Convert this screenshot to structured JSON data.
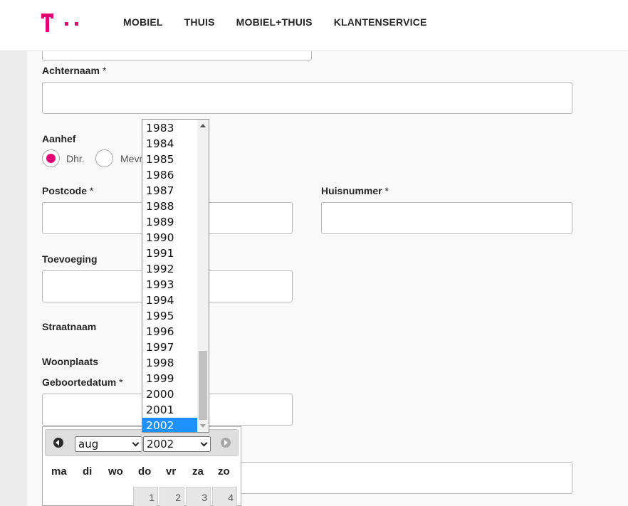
{
  "header": {
    "nav": [
      "MOBIEL",
      "THUIS",
      "MOBIEL+THUIS",
      "KLANTENSERVICE"
    ]
  },
  "form": {
    "achternaam_label": "Achternaam",
    "required_mark": "*",
    "aanhef_label": "Aanhef",
    "aanhef_options": [
      "Dhr.",
      "Mevr."
    ],
    "aanhef_selected": "Dhr.",
    "postcode_label": "Postcode",
    "huisnummer_label": "Huisnummer",
    "toevoeging_label": "Toevoeging",
    "straatnaam_label": "Straatnaam",
    "woonplaats_label": "Woonplaats",
    "geboortedatum_label": "Geboortedatum"
  },
  "year_dropdown": {
    "options": [
      "1983",
      "1984",
      "1985",
      "1986",
      "1987",
      "1988",
      "1989",
      "1990",
      "1991",
      "1992",
      "1993",
      "1994",
      "1995",
      "1996",
      "1997",
      "1998",
      "1999",
      "2000",
      "2001",
      "2002"
    ],
    "selected": "2002"
  },
  "datepicker": {
    "month": "aug",
    "year": "2002",
    "weekdays": [
      "ma",
      "di",
      "wo",
      "do",
      "vr",
      "za",
      "zo"
    ],
    "first_row_days": [
      "1",
      "2",
      "3",
      "4"
    ]
  },
  "colors": {
    "brand": "#e20074",
    "selection": "#1e90ff"
  }
}
